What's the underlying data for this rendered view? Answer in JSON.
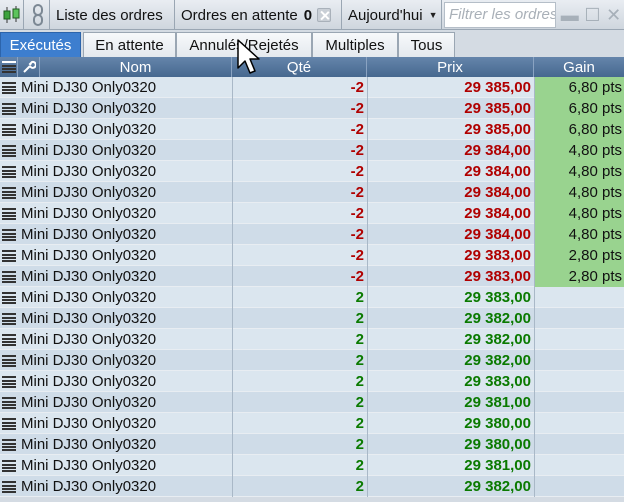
{
  "toolbar": {
    "orders_list_label": "Liste des ordres",
    "pending_label": "Ordres en attente",
    "pending_count": "0",
    "period_label": "Aujourd'hui",
    "filter_placeholder": "Filtrer les ordres"
  },
  "tabs": [
    "Exécutés",
    "En attente",
    "Annulés/Rejetés",
    "Multiples",
    "Tous"
  ],
  "columns": [
    "Nom",
    "Qté",
    "Prix",
    "Gain"
  ],
  "colors": {
    "accent": "#3d7ecf",
    "negative": "#b00000",
    "positive": "#0a7a00",
    "gain_bg": "#99d38f"
  },
  "rows": [
    {
      "name": "Mini DJ30 Only0320",
      "qty": "-2",
      "price": "29 385,00",
      "gain": "6,80 pts"
    },
    {
      "name": "Mini DJ30 Only0320",
      "qty": "-2",
      "price": "29 385,00",
      "gain": "6,80 pts"
    },
    {
      "name": "Mini DJ30 Only0320",
      "qty": "-2",
      "price": "29 385,00",
      "gain": "6,80 pts"
    },
    {
      "name": "Mini DJ30 Only0320",
      "qty": "-2",
      "price": "29 384,00",
      "gain": "4,80 pts"
    },
    {
      "name": "Mini DJ30 Only0320",
      "qty": "-2",
      "price": "29 384,00",
      "gain": "4,80 pts"
    },
    {
      "name": "Mini DJ30 Only0320",
      "qty": "-2",
      "price": "29 384,00",
      "gain": "4,80 pts"
    },
    {
      "name": "Mini DJ30 Only0320",
      "qty": "-2",
      "price": "29 384,00",
      "gain": "4,80 pts"
    },
    {
      "name": "Mini DJ30 Only0320",
      "qty": "-2",
      "price": "29 384,00",
      "gain": "4,80 pts"
    },
    {
      "name": "Mini DJ30 Only0320",
      "qty": "-2",
      "price": "29 383,00",
      "gain": "2,80 pts"
    },
    {
      "name": "Mini DJ30 Only0320",
      "qty": "-2",
      "price": "29 383,00",
      "gain": "2,80 pts"
    },
    {
      "name": "Mini DJ30 Only0320",
      "qty": "2",
      "price": "29 383,00",
      "gain": ""
    },
    {
      "name": "Mini DJ30 Only0320",
      "qty": "2",
      "price": "29 382,00",
      "gain": ""
    },
    {
      "name": "Mini DJ30 Only0320",
      "qty": "2",
      "price": "29 382,00",
      "gain": ""
    },
    {
      "name": "Mini DJ30 Only0320",
      "qty": "2",
      "price": "29 382,00",
      "gain": ""
    },
    {
      "name": "Mini DJ30 Only0320",
      "qty": "2",
      "price": "29 383,00",
      "gain": ""
    },
    {
      "name": "Mini DJ30 Only0320",
      "qty": "2",
      "price": "29 381,00",
      "gain": ""
    },
    {
      "name": "Mini DJ30 Only0320",
      "qty": "2",
      "price": "29 380,00",
      "gain": ""
    },
    {
      "name": "Mini DJ30 Only0320",
      "qty": "2",
      "price": "29 380,00",
      "gain": ""
    },
    {
      "name": "Mini DJ30 Only0320",
      "qty": "2",
      "price": "29 381,00",
      "gain": ""
    },
    {
      "name": "Mini DJ30 Only0320",
      "qty": "2",
      "price": "29 382,00",
      "gain": ""
    }
  ]
}
